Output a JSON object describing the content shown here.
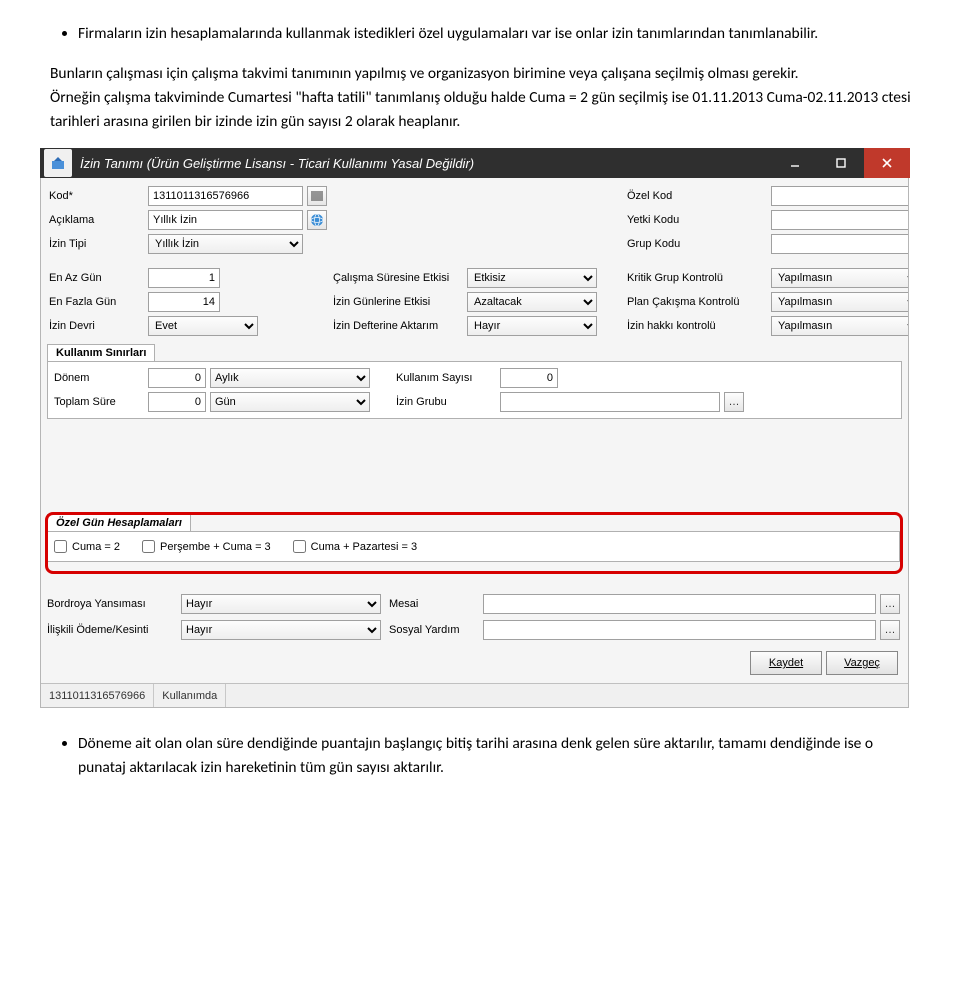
{
  "doc": {
    "bullet1": "Firmaların izin hesaplamalarında kullanmak istedikleri özel uygulamaları var ise onlar izin tanımlarından tanımlanabilir.",
    "para1": "Bunların çalışması için çalışma takvimi tanımının yapılmış ve organizasyon birimine veya çalışana seçilmiş olması gerekir.",
    "para2": "Örneğin çalışma takviminde Cumartesi \"hafta tatili\" tanımlanış olduğu halde Cuma = 2 gün seçilmiş ise 01.11.2013 Cuma-02.11.2013 ctesi tarihleri arasına girilen bir izinde izin gün sayısı 2 olarak heaplanır.",
    "bullet2": "Döneme ait olan olan süre dendiğinde puantajın başlangıç bitiş tarihi arasına denk gelen süre aktarılır, tamamı dendiğinde ise o punataj aktarılacak izin hareketinin tüm gün sayısı aktarılır."
  },
  "window": {
    "title": "İzin Tanımı (Ürün Geliştirme Lisansı - Ticari Kullanımı Yasal Değildir)"
  },
  "form": {
    "kod_lbl": "Kod*",
    "kod_val": "1311011316576966",
    "aciklama_lbl": "Açıklama",
    "aciklama_val": "Yıllık İzin",
    "izin_tipi_lbl": "İzin Tipi",
    "izin_tipi_val": "Yıllık İzin",
    "ozel_kod_lbl": "Özel Kod",
    "ozel_kod_val": "",
    "yetki_kodu_lbl": "Yetki Kodu",
    "yetki_kodu_val": "",
    "grup_kodu_lbl": "Grup Kodu",
    "grup_kodu_val": "",
    "en_az_gun_lbl": "En Az Gün",
    "en_az_gun_val": "1",
    "en_fazla_gun_lbl": "En Fazla Gün",
    "en_fazla_gun_val": "14",
    "izin_devri_lbl": "İzin Devri",
    "izin_devri_val": "Evet",
    "calisma_suresi_etkisi_lbl": "Çalışma Süresine Etkisi",
    "calisma_suresi_etkisi_val": "Etkisiz",
    "izin_gunleri_etkisi_lbl": "İzin Günlerine Etkisi",
    "izin_gunleri_etkisi_val": "Azaltacak",
    "izin_defteri_aktarim_lbl": "İzin Defterine Aktarım",
    "izin_defteri_aktarim_val": "Hayır",
    "kritik_grup_kontrol_lbl": "Kritik Grup Kontrolü",
    "kritik_grup_kontrol_val": "Yapılmasın",
    "plan_cakisma_lbl": "Plan Çakışma Kontrolü",
    "plan_cakisma_val": "Yapılmasın",
    "izin_hakki_kontrol_lbl": "İzin hakkı kontrolü",
    "izin_hakki_kontrol_val": "Yapılmasın"
  },
  "kullanim": {
    "tab": "Kullanım Sınırları",
    "donem_lbl": "Dönem",
    "donem_num": "0",
    "donem_unit": "Aylık",
    "kullanim_sayisi_lbl": "Kullanım Sayısı",
    "kullanim_sayisi_val": "0",
    "toplam_sure_lbl": "Toplam Süre",
    "toplam_sure_num": "0",
    "toplam_sure_unit": "Gün",
    "izin_grubu_lbl": "İzin Grubu",
    "izin_grubu_val": ""
  },
  "ozel_gun": {
    "tab": "Özel Gün Hesaplamaları",
    "opt1": "Cuma = 2",
    "opt2": "Perşembe + Cuma = 3",
    "opt3": "Cuma + Pazartesi = 3"
  },
  "lower": {
    "bordroya_lbl": "Bordroya Yansıması",
    "bordroya_val": "Hayır",
    "mesai_lbl": "Mesai",
    "mesai_val": "",
    "iliskili_lbl": "İlişkili Ödeme/Kesinti",
    "iliskili_val": "Hayır",
    "sosyal_lbl": "Sosyal Yardım",
    "sosyal_val": ""
  },
  "buttons": {
    "kaydet": "Kaydet",
    "vazgec": "Vazgeç"
  },
  "status": {
    "code": "1311011316576966",
    "state": "Kullanımda"
  }
}
